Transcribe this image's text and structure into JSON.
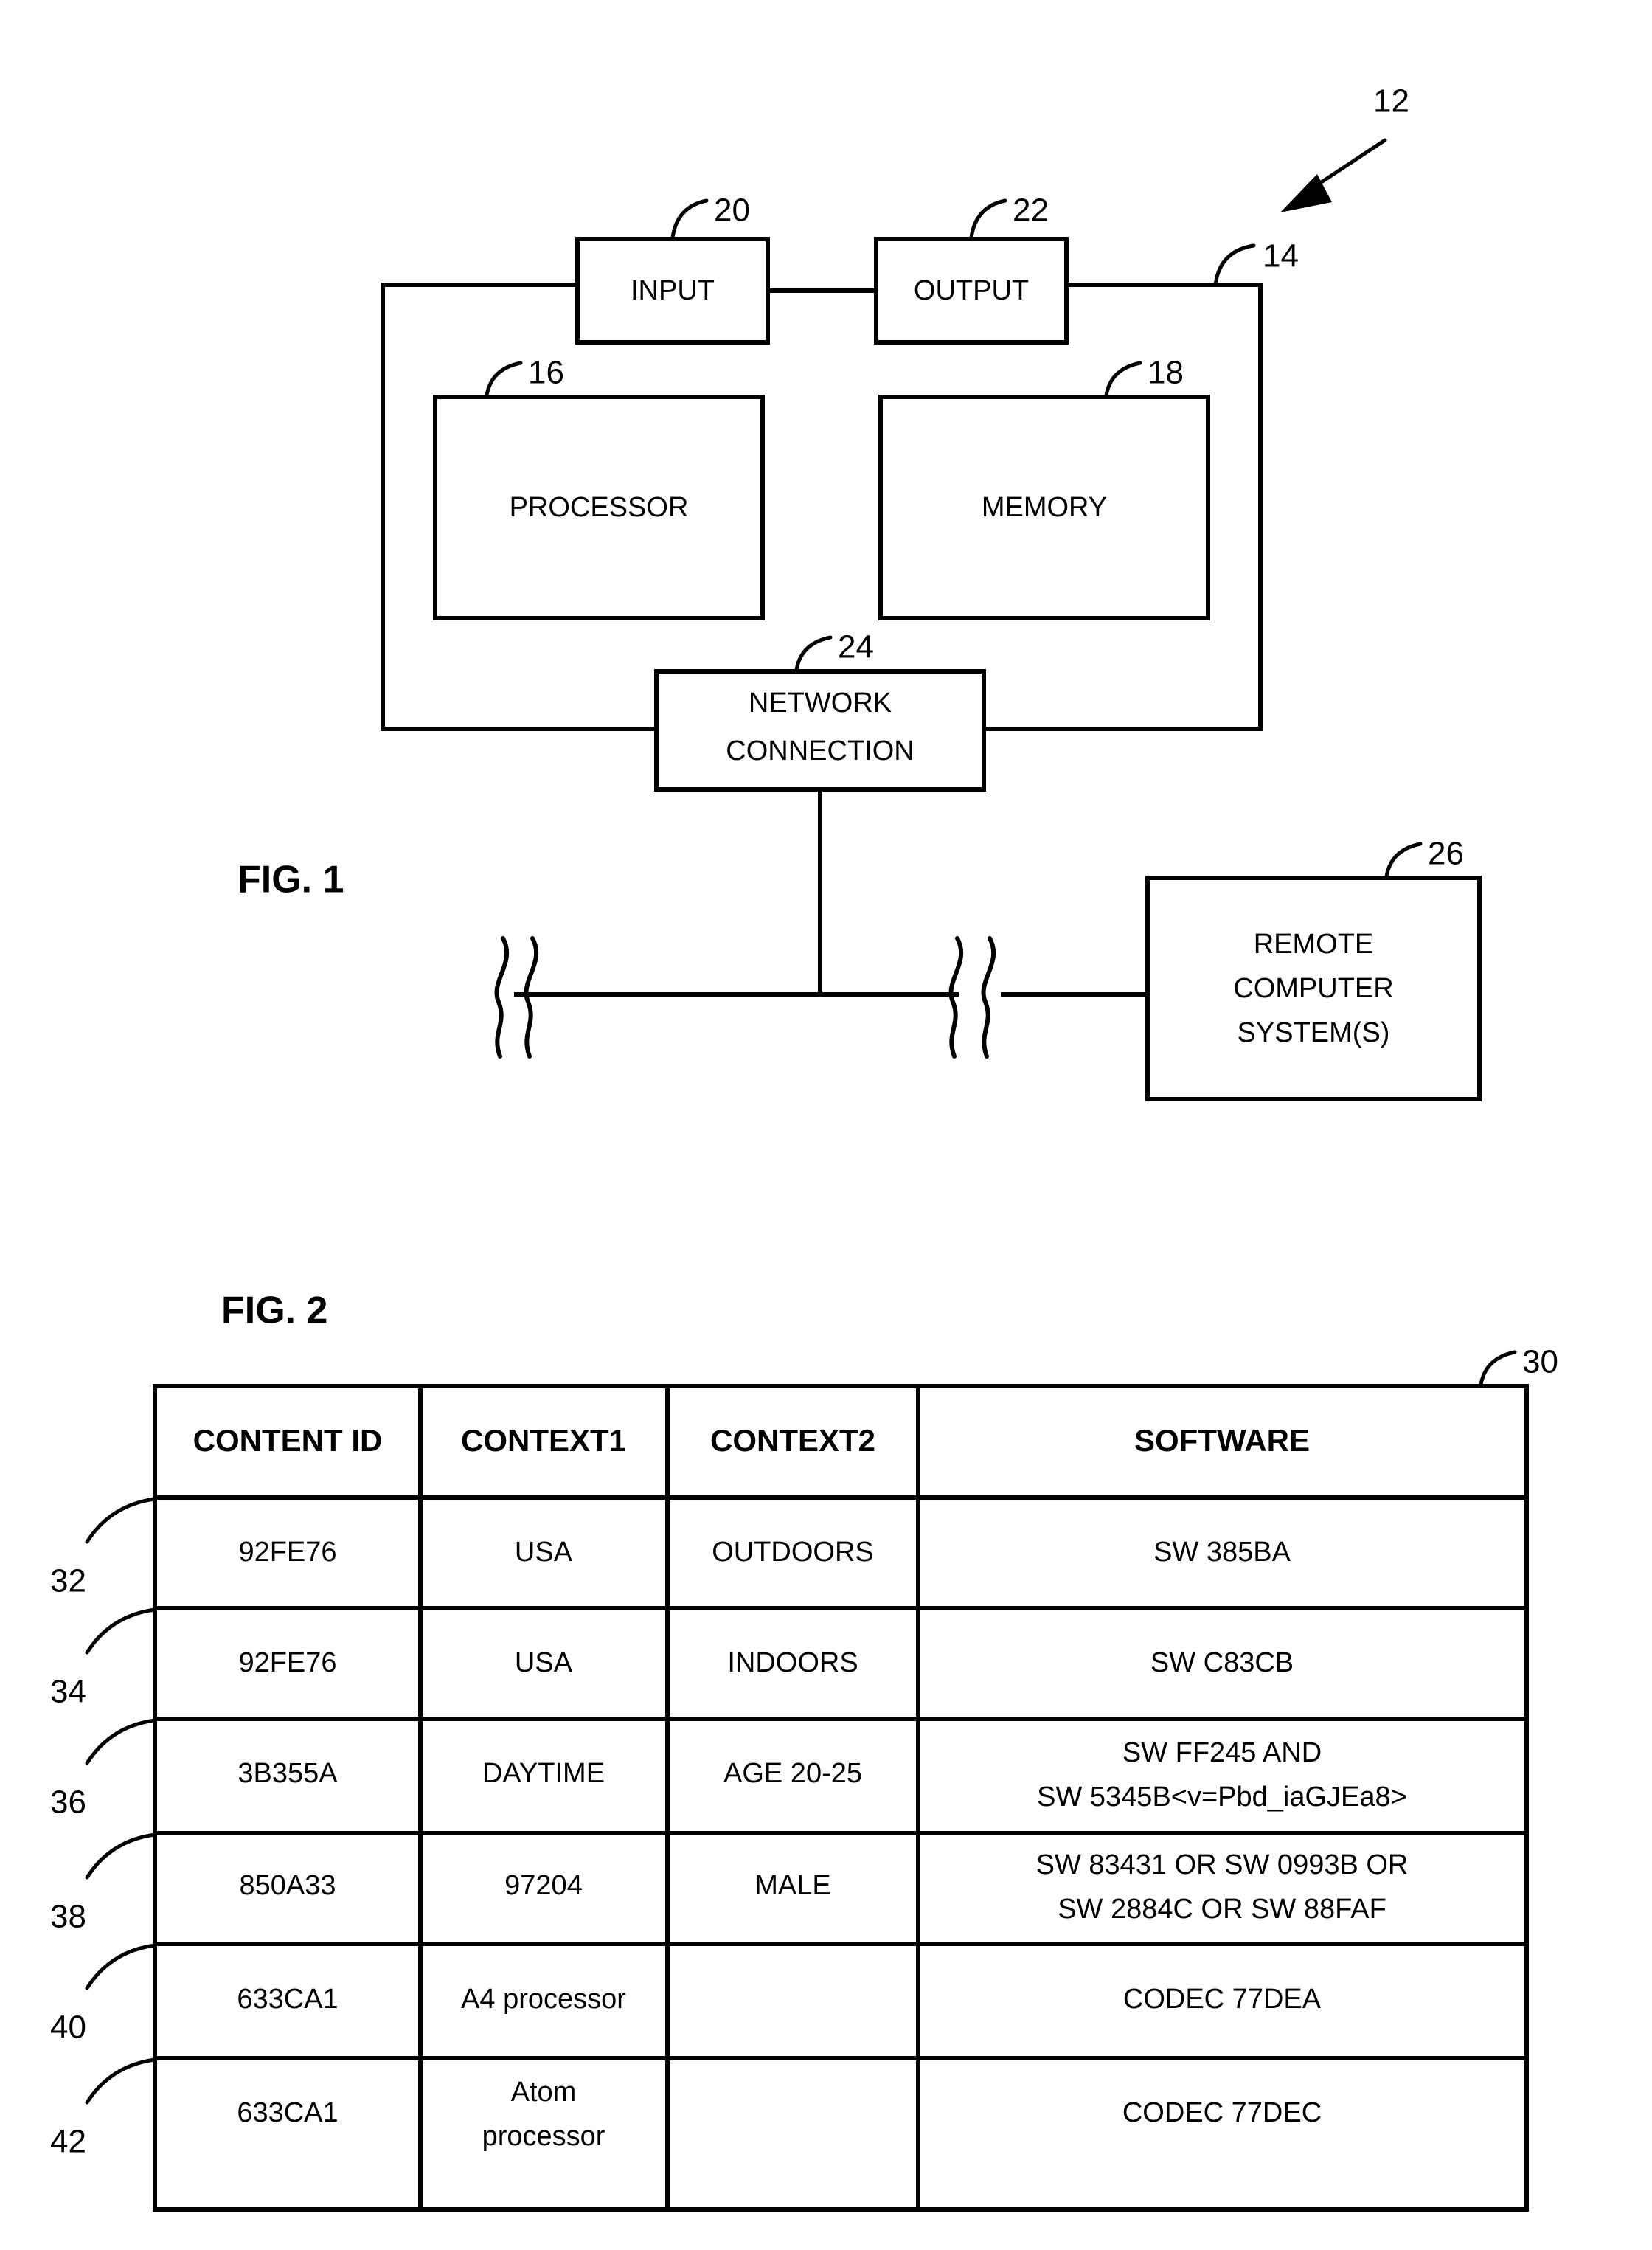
{
  "figure1": {
    "caption": "FIG. 1",
    "system_ref": "12",
    "boundary_ref": "14",
    "blocks": [
      {
        "id": "input",
        "label": "INPUT",
        "ref": "20"
      },
      {
        "id": "output",
        "label": "OUTPUT",
        "ref": "22"
      },
      {
        "id": "processor",
        "label": "PROCESSOR",
        "ref": "16"
      },
      {
        "id": "memory",
        "label": "MEMORY",
        "ref": "18"
      },
      {
        "id": "network",
        "label": "NETWORK\nCONNECTION",
        "ref": "24"
      },
      {
        "id": "remote",
        "label": "REMOTE\nCOMPUTER\nSYSTEM(S)",
        "ref": "26"
      }
    ],
    "block_labels": {
      "input": "INPUT",
      "output": "OUTPUT",
      "processor": "PROCESSOR",
      "memory": "MEMORY",
      "network_line1": "NETWORK",
      "network_line2": "CONNECTION",
      "remote_line1": "REMOTE",
      "remote_line2": "COMPUTER",
      "remote_line3": "SYSTEM(S)"
    },
    "refs": {
      "system": "12",
      "boundary": "14",
      "processor": "16",
      "memory": "18",
      "input": "20",
      "output": "22",
      "network": "24",
      "remote": "26"
    }
  },
  "figure2": {
    "caption": "FIG. 2",
    "table_ref": "30",
    "columns": [
      "CONTENT ID",
      "CONTEXT1",
      "CONTEXT2",
      "SOFTWARE"
    ],
    "rows": [
      {
        "ref": "32",
        "content_id": "92FE76",
        "context1": "USA",
        "context2": "OUTDOORS",
        "software_line1": "SW 385BA",
        "software_line2": ""
      },
      {
        "ref": "34",
        "content_id": "92FE76",
        "context1": "USA",
        "context2": "INDOORS",
        "software_line1": "SW C83CB",
        "software_line2": ""
      },
      {
        "ref": "36",
        "content_id": "3B355A",
        "context1": "DAYTIME",
        "context2": "AGE 20-25",
        "software_line1": "SW FF245 AND",
        "software_line2": "SW 5345B<v=Pbd_iaGJEa8>"
      },
      {
        "ref": "38",
        "content_id": "850A33",
        "context1": "97204",
        "context2": "MALE",
        "software_line1": "SW 83431 OR SW 0993B OR",
        "software_line2": "SW 2884C OR SW 88FAF"
      },
      {
        "ref": "40",
        "content_id": "633CA1",
        "context1": "A4 processor",
        "context2": "",
        "software_line1": "CODEC 77DEA",
        "software_line2": ""
      },
      {
        "ref": "42",
        "content_id": "633CA1",
        "context1_line1": "Atom",
        "context1_line2": "processor",
        "context1": "Atom processor",
        "context2": "",
        "software_line1": "CODEC 77DEC",
        "software_line2": ""
      }
    ]
  },
  "colors": {
    "ink": "#000000",
    "paper": "#ffffff"
  }
}
